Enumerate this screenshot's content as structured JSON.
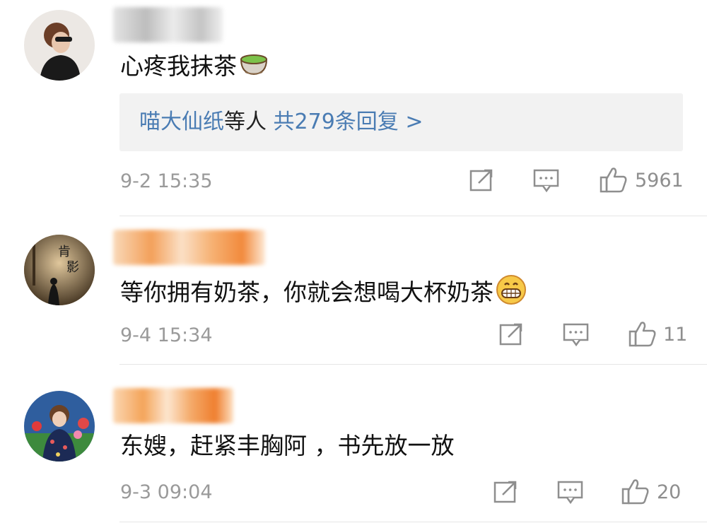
{
  "comments": [
    {
      "text": "心疼我抹茶",
      "emoji": "green-tea-emoji",
      "reply": {
        "users": "喵大仙纸",
        "mid": "等人",
        "count": "共279条回复 >"
      },
      "time": "9-2 15:35",
      "likes": "5961"
    },
    {
      "text": "等你拥有奶茶，你就会想喝大杯奶茶",
      "emoji": "grinning-face-emoji",
      "time": "9-4 15:34",
      "likes": "11"
    },
    {
      "text": "东嫂，赶紧丰胸阿 ，书先放一放",
      "time": "9-3 09:04",
      "likes": "20"
    }
  ],
  "colors": {
    "link": "#4a7cb3",
    "meta": "#9a9a9a",
    "reply_bg": "#f2f2f2",
    "icon": "#8e8e8e"
  }
}
